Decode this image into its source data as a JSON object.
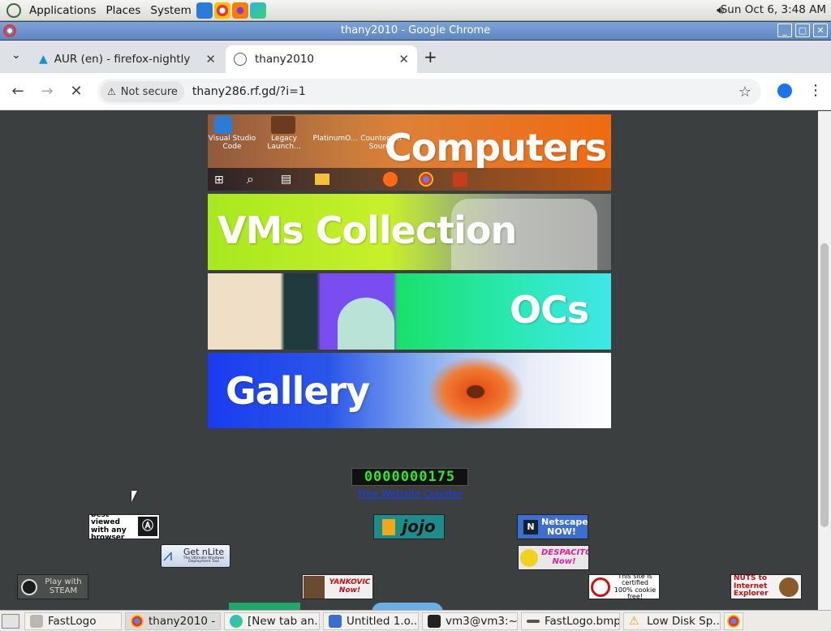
{
  "top_panel": {
    "menus": [
      "Applications",
      "Places",
      "System"
    ],
    "clock": "Sun Oct  6,  3:48 AM"
  },
  "window": {
    "title": "thany2010 - Google Chrome"
  },
  "tabs": [
    {
      "label": "AUR (en) - firefox-nightly"
    },
    {
      "label": "thany2010"
    }
  ],
  "toolbar": {
    "security_label": "Not secure",
    "url": "thany286.rf.gd/?i=1"
  },
  "page": {
    "banners": [
      {
        "label": "Computers"
      },
      {
        "label": "VMs Collection"
      },
      {
        "label": "OCs"
      },
      {
        "label": "Gallery"
      }
    ],
    "desktop_icon_labels": [
      "Visual Studio Code",
      "Legacy Launch...",
      "PlatinumO...",
      "Counter-Str Source"
    ],
    "counter_digits": "0000000175",
    "counter_link": "Free Website Counter",
    "badges": {
      "best_viewed": "best viewed with any browser",
      "jojo": "jojo",
      "netscape": "Netscape NOW!",
      "nlite": "Get nLite",
      "nlite_sub": "The Ultimate Windows Deployment Tool",
      "despacito": "DESPACITO Now!",
      "steam": "Play with STEAM",
      "yankovic": "YANKOVIC Now!",
      "cookie": "This site is certified 100% cookie free!",
      "ie": "NUTS to Internet Explorer"
    }
  },
  "taskbar": {
    "items": [
      {
        "label": "FastLogo"
      },
      {
        "label": "thany2010 - ..."
      },
      {
        "label": "[New tab an..."
      },
      {
        "label": "Untitled 1.o..."
      },
      {
        "label": "vm3@vm3:~..."
      },
      {
        "label": "FastLogo.bmp"
      },
      {
        "label": "Low Disk Sp..."
      }
    ]
  }
}
